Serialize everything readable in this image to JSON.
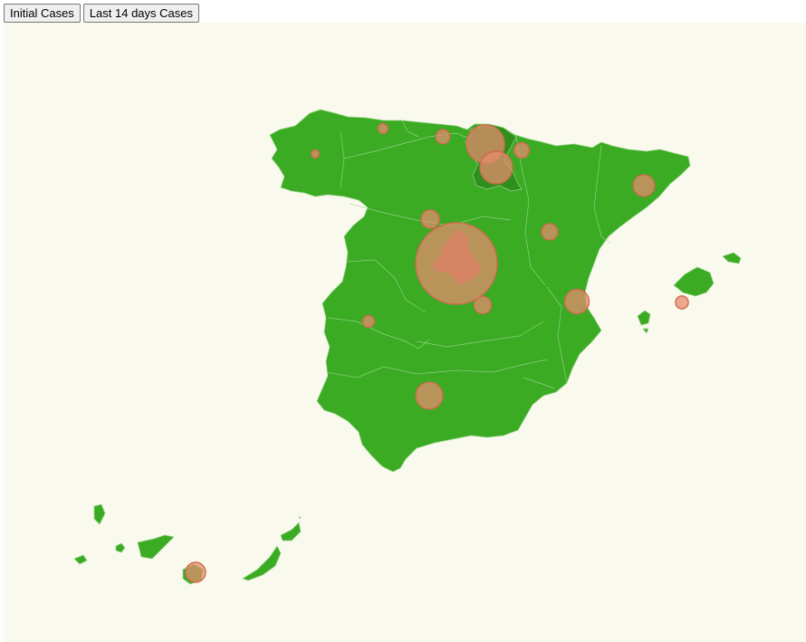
{
  "buttons": {
    "initial_label": "Initial Cases",
    "last14_label": "Last 14 days Cases"
  },
  "colors": {
    "background": "#f9f9ee",
    "land": "#3aab23",
    "land_highlight": "#2f8f1c",
    "bubble_fill": "#e48c6e",
    "bubble_stroke": "#d26a4e"
  },
  "map": {
    "region": "Spain",
    "bubbles": [
      {
        "id": "madrid",
        "value": 1.0
      },
      {
        "id": "navarra",
        "value": 0.22
      },
      {
        "id": "la-rioja",
        "value": 0.16
      },
      {
        "id": "andalucia",
        "value": 0.11
      },
      {
        "id": "valencia",
        "value": 0.09
      },
      {
        "id": "cataluna",
        "value": 0.07
      },
      {
        "id": "canarias",
        "value": 0.06
      },
      {
        "id": "castilla-leon",
        "value": 0.05
      },
      {
        "id": "castilla-la-mancha",
        "value": 0.045
      },
      {
        "id": "aragon",
        "value": 0.04
      },
      {
        "id": "pais-vasco",
        "value": 0.035
      },
      {
        "id": "cantabria",
        "value": 0.03
      },
      {
        "id": "baleares",
        "value": 0.025
      },
      {
        "id": "extremadura",
        "value": 0.02
      },
      {
        "id": "asturias",
        "value": 0.015
      },
      {
        "id": "galicia",
        "value": 0.01
      }
    ]
  }
}
